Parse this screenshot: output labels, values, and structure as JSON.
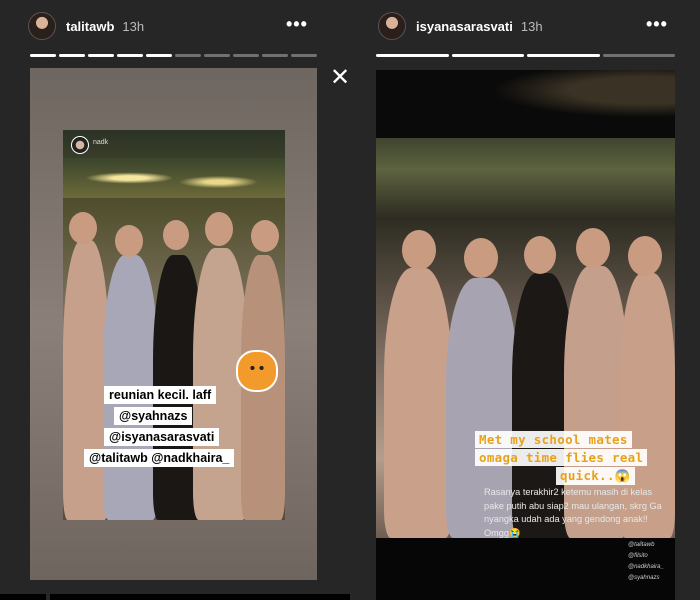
{
  "left_story": {
    "username": "talitawb",
    "time": "13h",
    "repost_username": "nadk",
    "tags": [
      "reunian kecil. laff",
      "@syahnazs",
      "@isyanasarasvati",
      "@talitawb  @nadkhaira_"
    ],
    "progress_segments": 10,
    "progress_done": 5
  },
  "right_story": {
    "username": "isyanasarasvati",
    "time": "13h",
    "caption_lines": [
      "Met my school mates",
      "omaga time flies real",
      "quick..😱"
    ],
    "sub_caption": "Rasanya terakhir2 ketemu masih di kelas pake putih abu siap2 mau ulangan, skrg Ga nyangka udah ada yang gendong anak!! Omgg😭",
    "mini_tags": [
      "@talitawb",
      "@filsito",
      "@nadkhaira_",
      "@syahnazs"
    ],
    "progress_segments": 4,
    "progress_done": 3
  },
  "icons": {
    "more": "more-horizontal-icon",
    "close": "close-icon",
    "sticker": "cat-sticker-icon"
  },
  "glyphs": {
    "more": "•••",
    "close": "✕"
  }
}
